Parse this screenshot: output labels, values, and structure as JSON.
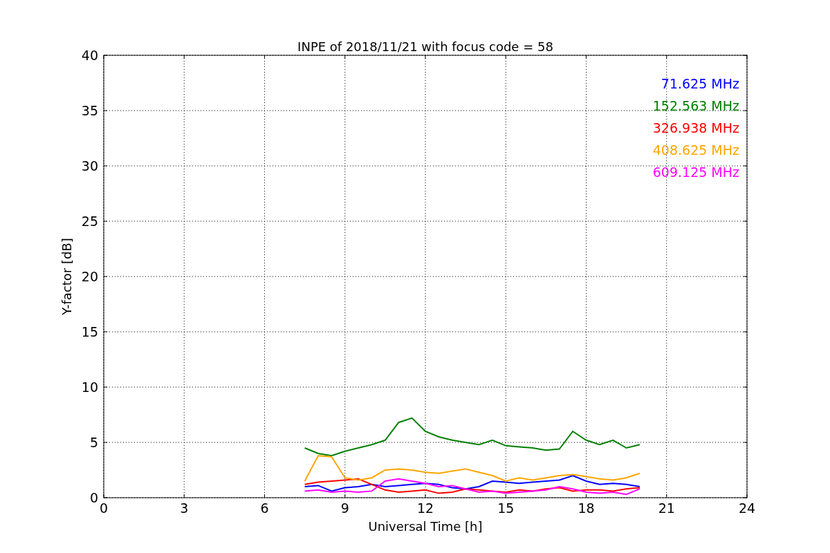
{
  "figure": {
    "chart_data": {
      "type": "line",
      "title": "INPE of 2018/11/21 with focus code = 58",
      "xlabel": "Universal Time [h]",
      "ylabel": "Y-factor [dB]",
      "x": [
        7.5,
        8,
        8.5,
        9,
        9.5,
        10,
        10.5,
        11,
        11.5,
        12,
        12.5,
        13,
        13.5,
        14,
        14.5,
        15,
        15.5,
        16,
        16.5,
        17,
        17.5,
        18,
        18.5,
        19,
        19.5,
        20
      ],
      "series": [
        {
          "name": "71.625 MHz",
          "color": "#0000ff",
          "values": [
            1.0,
            1.1,
            0.6,
            0.9,
            1.0,
            1.2,
            1.0,
            1.1,
            1.2,
            1.3,
            1.2,
            0.9,
            0.8,
            1.0,
            1.5,
            1.4,
            1.3,
            1.4,
            1.5,
            1.6,
            2.0,
            1.5,
            1.2,
            1.3,
            1.2,
            1.0
          ]
        },
        {
          "name": "152.563 MHz",
          "color": "#008000",
          "values": [
            4.5,
            4.0,
            3.8,
            4.2,
            4.5,
            4.8,
            5.2,
            6.8,
            7.2,
            6.0,
            5.5,
            5.2,
            5.0,
            4.8,
            5.2,
            4.7,
            4.6,
            4.5,
            4.3,
            4.4,
            6.0,
            5.2,
            4.8,
            5.2,
            4.5,
            4.8
          ]
        },
        {
          "name": "326.938 MHz",
          "color": "#ff0000",
          "values": [
            1.2,
            1.4,
            1.5,
            1.6,
            1.7,
            1.2,
            0.7,
            0.5,
            0.6,
            0.7,
            0.4,
            0.5,
            0.8,
            0.7,
            0.6,
            0.5,
            0.7,
            0.6,
            0.8,
            0.9,
            0.6,
            0.7,
            0.7,
            0.6,
            0.8,
            0.9
          ]
        },
        {
          "name": "408.625 MHz",
          "color": "#ffa500",
          "values": [
            1.5,
            3.8,
            3.7,
            1.8,
            1.6,
            1.8,
            2.5,
            2.6,
            2.5,
            2.3,
            2.2,
            2.4,
            2.6,
            2.3,
            2.0,
            1.5,
            1.8,
            1.6,
            1.8,
            2.0,
            2.1,
            1.9,
            1.7,
            1.6,
            1.8,
            2.2
          ]
        },
        {
          "name": "609.125 MHz",
          "color": "#ff00ff",
          "values": [
            0.6,
            0.7,
            0.5,
            0.6,
            0.5,
            0.6,
            1.5,
            1.7,
            1.5,
            1.3,
            1.0,
            1.1,
            0.8,
            0.5,
            0.6,
            0.4,
            0.5,
            0.6,
            0.7,
            1.0,
            0.8,
            0.5,
            0.4,
            0.5,
            0.3,
            0.8
          ]
        }
      ],
      "xlim": [
        0,
        24
      ],
      "ylim": [
        0,
        40
      ],
      "xticks": [
        0,
        3,
        6,
        9,
        12,
        15,
        18,
        21,
        24
      ],
      "yticks": [
        0,
        5,
        10,
        15,
        20,
        25,
        30,
        35,
        40
      ],
      "grid": true
    }
  }
}
